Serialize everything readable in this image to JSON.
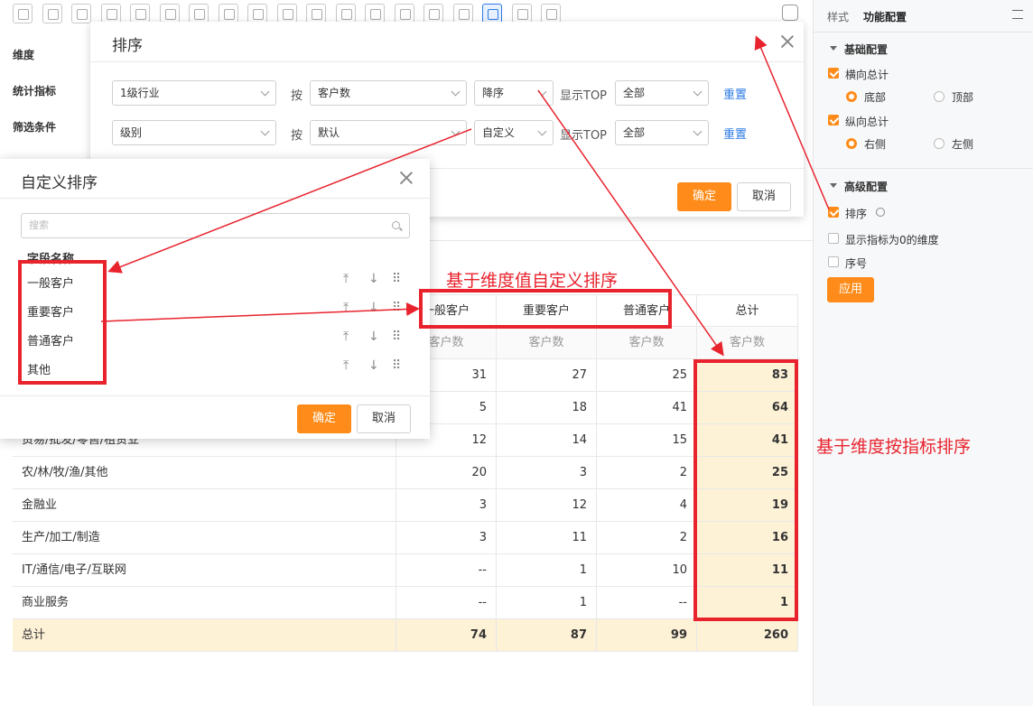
{
  "toolbar": {
    "icons": [
      "table-icon",
      "line-chart-icon",
      "pie-chart-icon",
      "funnel-icon",
      "funnel-icon",
      "grid-icon",
      "combo-chart-icon",
      "card-icon",
      "gauge-icon",
      "radar-icon",
      "globe-icon",
      "globe-icon",
      "dot-icon",
      "bar-icon",
      "line-icon",
      "heat-icon",
      "pivot-table-icon",
      "scatter-icon",
      "help-icon"
    ],
    "active_index": 16
  },
  "left_labels": {
    "dimension": "维度",
    "metrics": "统计指标",
    "filters": "筛选条件"
  },
  "right_panel": {
    "tabs": {
      "style": "样式",
      "function": "功能配置"
    },
    "basic": {
      "title": "基础配置",
      "row_total": {
        "label": "横向总计",
        "checked": true,
        "options": [
          "底部",
          "顶部"
        ],
        "selected": "底部"
      },
      "col_total": {
        "label": "纵向总计",
        "checked": true,
        "options": [
          "右侧",
          "左侧"
        ],
        "selected": "右侧"
      }
    },
    "advanced": {
      "title": "高级配置",
      "sort": {
        "label": "排序",
        "checked": true
      },
      "show_zero": {
        "label": "显示指标为0的维度",
        "checked": false
      },
      "serial": {
        "label": "序号",
        "checked": false
      }
    },
    "apply": "应用"
  },
  "sort_dialog": {
    "title": "排序",
    "by": "按",
    "show_top": "显示TOP",
    "reset": "重置",
    "rows": [
      {
        "field": "1级行业",
        "metric": "客户数",
        "order": "降序",
        "top": "全部"
      },
      {
        "field": "级别",
        "metric": "默认",
        "order": "自定义",
        "top": "全部"
      }
    ],
    "confirm": "确定",
    "cancel": "取消"
  },
  "custom_dialog": {
    "title": "自定义排序",
    "search_placeholder": "搜索",
    "field_header": "字段名称",
    "items": [
      "一般客户",
      "重要客户",
      "普通客户",
      "其他"
    ],
    "confirm": "确定",
    "cancel": "取消"
  },
  "table": {
    "columns": [
      "一般客户",
      "重要客户",
      "普通客户",
      "总计"
    ],
    "sub_header": "客户数",
    "rows": [
      {
        "name": "",
        "values": [
          "31",
          "27",
          "25",
          "83"
        ]
      },
      {
        "name": "",
        "values": [
          "5",
          "18",
          "41",
          "64"
        ]
      },
      {
        "name": "贸易/批发/零售/租赁业",
        "values": [
          "12",
          "14",
          "15",
          "41"
        ]
      },
      {
        "name": "农/林/牧/渔/其他",
        "values": [
          "20",
          "3",
          "2",
          "25"
        ]
      },
      {
        "name": "金融业",
        "values": [
          "3",
          "12",
          "4",
          "19"
        ]
      },
      {
        "name": "生产/加工/制造",
        "values": [
          "3",
          "11",
          "2",
          "16"
        ]
      },
      {
        "name": "IT/通信/电子/互联网",
        "values": [
          "--",
          "1",
          "10",
          "11"
        ]
      },
      {
        "name": "商业服务",
        "values": [
          "--",
          "1",
          "--",
          "1"
        ]
      }
    ],
    "total": {
      "name": "总计",
      "values": [
        "74",
        "87",
        "99",
        "260"
      ]
    }
  },
  "annotations": {
    "custom_sort": "基于维度值自定义排序",
    "metric_sort": "基于维度按指标排序"
  }
}
